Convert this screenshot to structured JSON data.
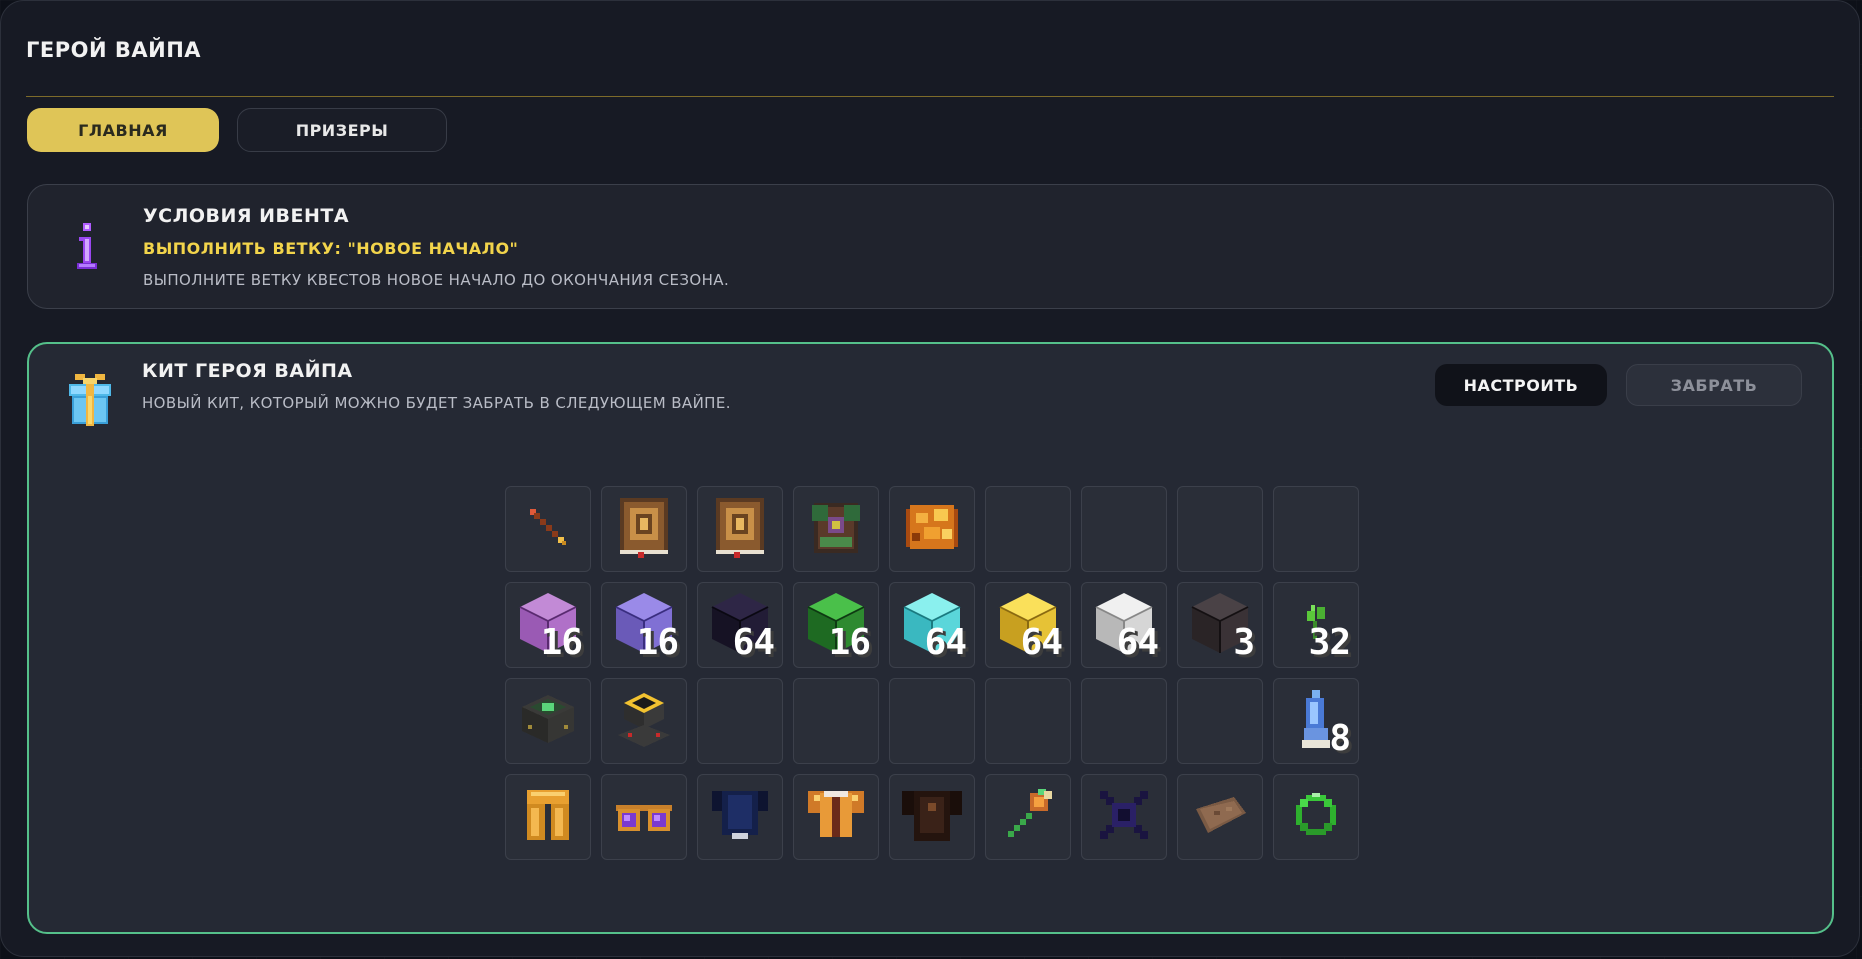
{
  "window": {
    "title": "Герой вайпа"
  },
  "tabs": [
    {
      "label": "Главная",
      "active": true
    },
    {
      "label": "Призеры",
      "active": false
    }
  ],
  "conditions": {
    "title": "Условия ивента",
    "task": "Выполнить ветку: \"Новое начало\"",
    "description": "Выполните ветку квестов Новое начало до окончания сезона.",
    "icon": "info-icon"
  },
  "kit": {
    "title": "Кит героя вайпа",
    "description": "Новый кит, который можно будет забрать в следующем вайпе.",
    "icon": "gift-icon",
    "buttons": {
      "configure": "Настроить",
      "take": "Забрать"
    },
    "accent_color": "#55c08a",
    "items": [
      {
        "icon": "staff-icon",
        "count": ""
      },
      {
        "icon": "spellbook-icon",
        "count": ""
      },
      {
        "icon": "spellbook-icon",
        "count": ""
      },
      {
        "icon": "backpack-icon",
        "count": ""
      },
      {
        "icon": "amber-ore-icon",
        "count": ""
      },
      {
        "icon": "empty",
        "count": ""
      },
      {
        "icon": "empty",
        "count": ""
      },
      {
        "icon": "empty",
        "count": ""
      },
      {
        "icon": "empty",
        "count": ""
      },
      {
        "icon": "purpur-block-icon",
        "count": "16"
      },
      {
        "icon": "amethyst-block-icon",
        "count": "16"
      },
      {
        "icon": "obsidian-block-icon",
        "count": "64"
      },
      {
        "icon": "emerald-cube-icon",
        "count": "16"
      },
      {
        "icon": "diamond-block-icon",
        "count": "64"
      },
      {
        "icon": "gold-block-icon",
        "count": "64"
      },
      {
        "icon": "iron-block-icon",
        "count": "64"
      },
      {
        "icon": "netherite-block-icon",
        "count": "3"
      },
      {
        "icon": "sprout-icon",
        "count": "32"
      },
      {
        "icon": "altar-icon",
        "count": ""
      },
      {
        "icon": "pedestal-icon",
        "count": ""
      },
      {
        "icon": "empty",
        "count": ""
      },
      {
        "icon": "empty",
        "count": ""
      },
      {
        "icon": "empty",
        "count": ""
      },
      {
        "icon": "empty",
        "count": ""
      },
      {
        "icon": "empty",
        "count": ""
      },
      {
        "icon": "empty",
        "count": ""
      },
      {
        "icon": "blue-figure-icon",
        "count": "8"
      },
      {
        "icon": "golden-leggings-icon",
        "count": ""
      },
      {
        "icon": "goggles-icon",
        "count": ""
      },
      {
        "icon": "dark-chestplate-icon",
        "count": ""
      },
      {
        "icon": "golden-chestplate-icon",
        "count": ""
      },
      {
        "icon": "black-chestplate-icon",
        "count": ""
      },
      {
        "icon": "axe-icon",
        "count": ""
      },
      {
        "icon": "void-star-icon",
        "count": ""
      },
      {
        "icon": "leather-hide-icon",
        "count": ""
      },
      {
        "icon": "emerald-ring-icon",
        "count": ""
      }
    ]
  }
}
